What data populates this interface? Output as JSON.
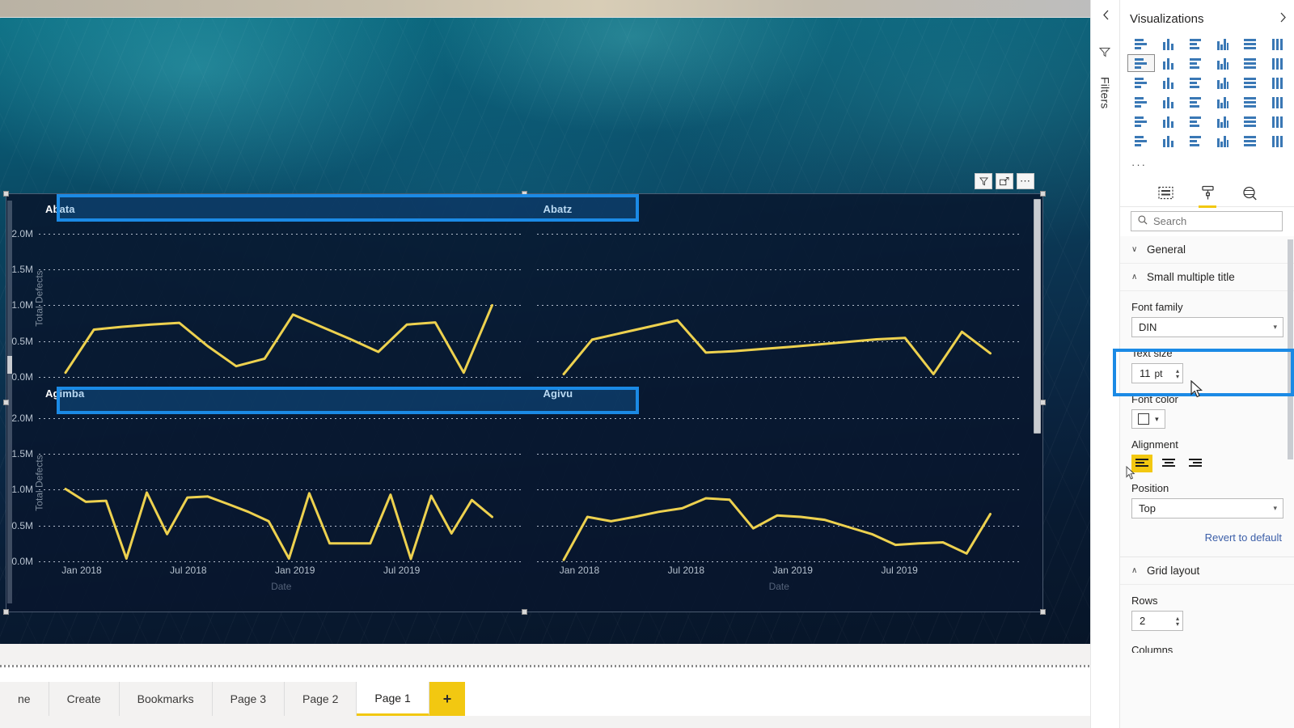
{
  "report": {
    "visual_header": {
      "filter_icon": "filter-funnel-icon",
      "focus_icon": "focus-mode-icon",
      "more_label": "⋯"
    }
  },
  "chart_data": {
    "type": "line",
    "title": "",
    "small_multiples": true,
    "rows": 2,
    "columns": 2,
    "xlabel": "Date",
    "ylabel": "Total Defects",
    "ylim": [
      0,
      2200000
    ],
    "yticks": [
      "0.0M",
      "0.5M",
      "1.0M",
      "1.5M",
      "2.0M"
    ],
    "ytick_values": [
      0,
      500000,
      1000000,
      1500000,
      2000000
    ],
    "xticks": [
      "Jan 2018",
      "Jul 2018",
      "Jan 2019",
      "Jul 2019"
    ],
    "xtick_positions": [
      0.055,
      0.275,
      0.495,
      0.715
    ],
    "grid": true,
    "legend": "none",
    "line_color": "#edd14f",
    "panels": [
      {
        "title": "Abata",
        "values": [
          60000,
          660000,
          700000,
          730000,
          755000,
          430000,
          150000,
          255000,
          870000,
          700000,
          530000,
          350000,
          730000,
          760000,
          60000,
          1000000
        ]
      },
      {
        "title": "Abatz",
        "values": [
          40000,
          520000,
          610000,
          700000,
          790000,
          340000,
          360000,
          390000,
          420000,
          455000,
          490000,
          525000,
          545000,
          40000,
          630000,
          330000
        ]
      },
      {
        "title": "Agimba",
        "values": [
          1010000,
          830000,
          845000,
          40000,
          960000,
          380000,
          890000,
          905000,
          800000,
          690000,
          560000,
          40000,
          950000,
          250000,
          250000,
          250000,
          930000,
          35000,
          915000,
          390000,
          855000,
          620000
        ]
      },
      {
        "title": "Agivu",
        "values": [
          20000,
          620000,
          560000,
          620000,
          690000,
          740000,
          880000,
          860000,
          460000,
          640000,
          620000,
          580000,
          480000,
          380000,
          230000,
          250000,
          265000,
          110000,
          660000
        ]
      }
    ]
  },
  "pagebar": {
    "tabs": [
      {
        "label": "ne",
        "active": false
      },
      {
        "label": "Create",
        "active": false
      },
      {
        "label": "Bookmarks",
        "active": false
      },
      {
        "label": "Page 3",
        "active": false
      },
      {
        "label": "Page 2",
        "active": false
      },
      {
        "label": "Page 1",
        "active": true
      }
    ],
    "add_label": "+"
  },
  "filters_rail": {
    "collapse_icon": "chevron-left-icon",
    "funnel_icon": "filter-funnel-icon",
    "label": "Filters"
  },
  "visualizations_pane": {
    "title": "Visualizations",
    "collapse_icon": "chevron-right-icon",
    "expand_icon": "chevron-left-icon",
    "more_icon": "ellipsis-icon",
    "gallery_icons": [
      "stacked-bar-chart-icon",
      "stacked-column-chart-icon",
      "clustered-bar-chart-icon",
      "clustered-column-chart-icon",
      "100-stacked-bar-chart-icon",
      "100-stacked-column-chart-icon",
      "line-chart-icon",
      "area-chart-icon",
      "stacked-area-chart-icon",
      "line-stacked-column-chart-icon",
      "line-clustered-column-chart-icon",
      "ribbon-chart-icon",
      "waterfall-chart-icon",
      "funnel-chart-icon",
      "scatter-chart-icon",
      "pie-chart-icon",
      "donut-chart-icon",
      "treemap-icon",
      "map-icon",
      "filled-map-icon",
      "shape-map-icon",
      "azure-map-icon",
      "gauge-icon",
      "card-icon",
      "multi-row-card-icon",
      "kpi-icon",
      "slicer-icon",
      "table-icon",
      "matrix-icon",
      "r-script-visual-icon",
      "python-visual-icon",
      "key-influencers-icon",
      "decomposition-tree-icon",
      "q-and-a-icon",
      "smart-narrative-icon",
      "paginated-report-icon"
    ],
    "selected_gallery_icon": "line-chart-icon",
    "format_tabs": [
      {
        "name": "fields-tab",
        "active": false
      },
      {
        "name": "format-tab",
        "active": true
      },
      {
        "name": "analytics-tab",
        "active": false
      }
    ],
    "search": {
      "placeholder": "Search",
      "value": "",
      "icon": "search-icon"
    },
    "sections": {
      "general": {
        "label": "General",
        "expanded": false,
        "caret": "∨"
      },
      "small_multiple_title": {
        "label": "Small multiple title",
        "expanded": true,
        "caret": "∧",
        "font_family": {
          "label": "Font family",
          "value": "DIN"
        },
        "text_size": {
          "label": "Text size",
          "value": "11",
          "unit": "pt"
        },
        "font_color": {
          "label": "Font color",
          "value": "#ffffff"
        },
        "alignment": {
          "label": "Alignment",
          "options": [
            "align-left",
            "align-center",
            "align-right"
          ],
          "selected": "align-left"
        },
        "position": {
          "label": "Position",
          "value": "Top"
        },
        "revert": "Revert to default"
      },
      "grid_layout": {
        "label": "Grid layout",
        "expanded": true,
        "caret": "∧",
        "rows": {
          "label": "Rows",
          "value": "2"
        },
        "columns": {
          "label": "Columns"
        }
      }
    }
  },
  "annotations": {
    "accent_color": "#1b8ae5",
    "title_box": "small-multiple-titles-highlight",
    "textsize_box": "text-size-highlight"
  }
}
